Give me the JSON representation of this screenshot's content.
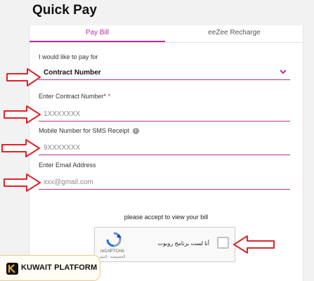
{
  "page": {
    "title": "Quick Pay"
  },
  "tabs": [
    {
      "label": "Pay Bill",
      "active": true
    },
    {
      "label": "eeZee Recharge",
      "active": false
    }
  ],
  "form": {
    "pay_for_label": "I would like to pay for",
    "pay_for_value": "Contract Number",
    "contract_label": "Enter Contract Number*",
    "contract_required_mark": "*",
    "contract_placeholder": "1XXXXXXX",
    "mobile_label": "Mobile Number for SMS Receipt",
    "mobile_placeholder": "9XXXXXXX",
    "email_label": "Enter Email Address",
    "email_placeholder": "xxx@gmail.com"
  },
  "captcha": {
    "accept_text": "please accept to view your bill",
    "label": "أنا لست برنامج روبوت",
    "brand": "reCAPTCHA",
    "terms": "الخصوصية - البنود"
  },
  "badge": {
    "text": "KUWAIT PLATFORM"
  },
  "colors": {
    "accent": "#b6339a",
    "arrow": "#e0242a",
    "required": "#d4145a"
  },
  "icons": [
    "chevron-down-icon",
    "info-icon",
    "recaptcha-logo-icon",
    "red-arrow-icon",
    "kuwait-platform-logo-icon"
  ]
}
